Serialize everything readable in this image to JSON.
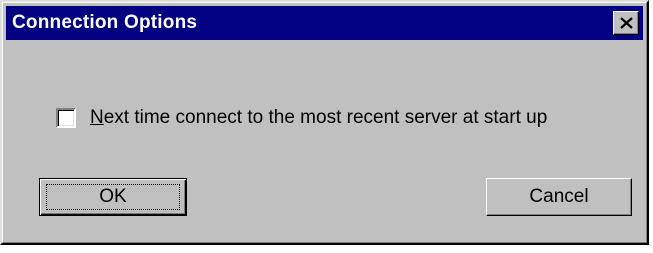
{
  "window": {
    "title": "Connection Options",
    "close_icon": "close-icon"
  },
  "option": {
    "accelerator": "N",
    "label_rest": "ext time connect to the most recent server at start up",
    "checked": false
  },
  "buttons": {
    "ok_label": "OK",
    "cancel_label": "Cancel"
  },
  "colors": {
    "title_bar": "#000080",
    "dialog_face": "#c0c0c0"
  }
}
